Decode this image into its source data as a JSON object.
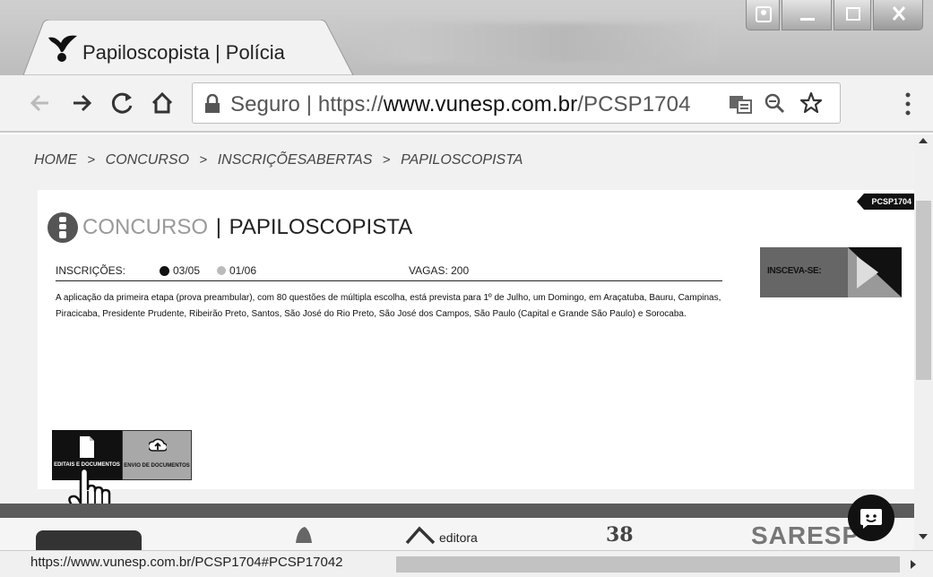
{
  "browser": {
    "tab_title": "Papiloscopista | Polícia",
    "url_secure_label": "Seguro",
    "url_separator": "|",
    "url_scheme": "https://",
    "url_host": "www.vunesp.com.br",
    "url_path": "/PCSP1704",
    "status_url": "https://www.vunesp.com.br/PCSP1704#PCSP17042"
  },
  "breadcrumb": {
    "items": [
      "HOME",
      "CONCURSO",
      "INSCRIÇÕESABERTAS",
      "PAPILOSCOPISTA"
    ],
    "separator": ">"
  },
  "page": {
    "code_tag": "PCSP1704",
    "title_light": "CONCURSO",
    "title_bar": "|",
    "title_dark": "PAPILOSCOPISTA",
    "inscricoes_label": "INSCRIÇÕES:",
    "date_start": "03/05",
    "date_end": "01/06",
    "vagas": "VAGAS: 200",
    "description": "A aplicação da primeira etapa (prova preambular), com 80 questões de múltipla escolha, está prevista para 1º de Julho, um Domingo, em Araçatuba, Bauru, Campinas, Piracicaba, Presidente Prudente, Ribeirão Preto, Santos, São José do Rio Preto, São José dos Campos, São Paulo (Capital e Grande São Paulo) e Sorocaba.",
    "inscreva_label": "INSCEVA-SE:",
    "btn_docs_label": "EDITAIS E DOCUMENTOS",
    "btn_envio_label": "ENVIO DE DOCUMENTOS"
  },
  "footer_logos": {
    "editora": "editora",
    "logo_38": "38",
    "saresp": "SARESP"
  },
  "icons": {
    "tab_logo": "bird-logo-icon",
    "back": "arrow-left-icon",
    "forward": "arrow-right-icon",
    "reload": "reload-icon",
    "home": "home-icon",
    "lock": "lock-icon",
    "translate": "translate-icon",
    "zoom": "zoom-icon",
    "star": "star-icon",
    "menu": "kebab-menu-icon",
    "chat": "chat-icon",
    "cursor": "hand-cursor-icon"
  }
}
